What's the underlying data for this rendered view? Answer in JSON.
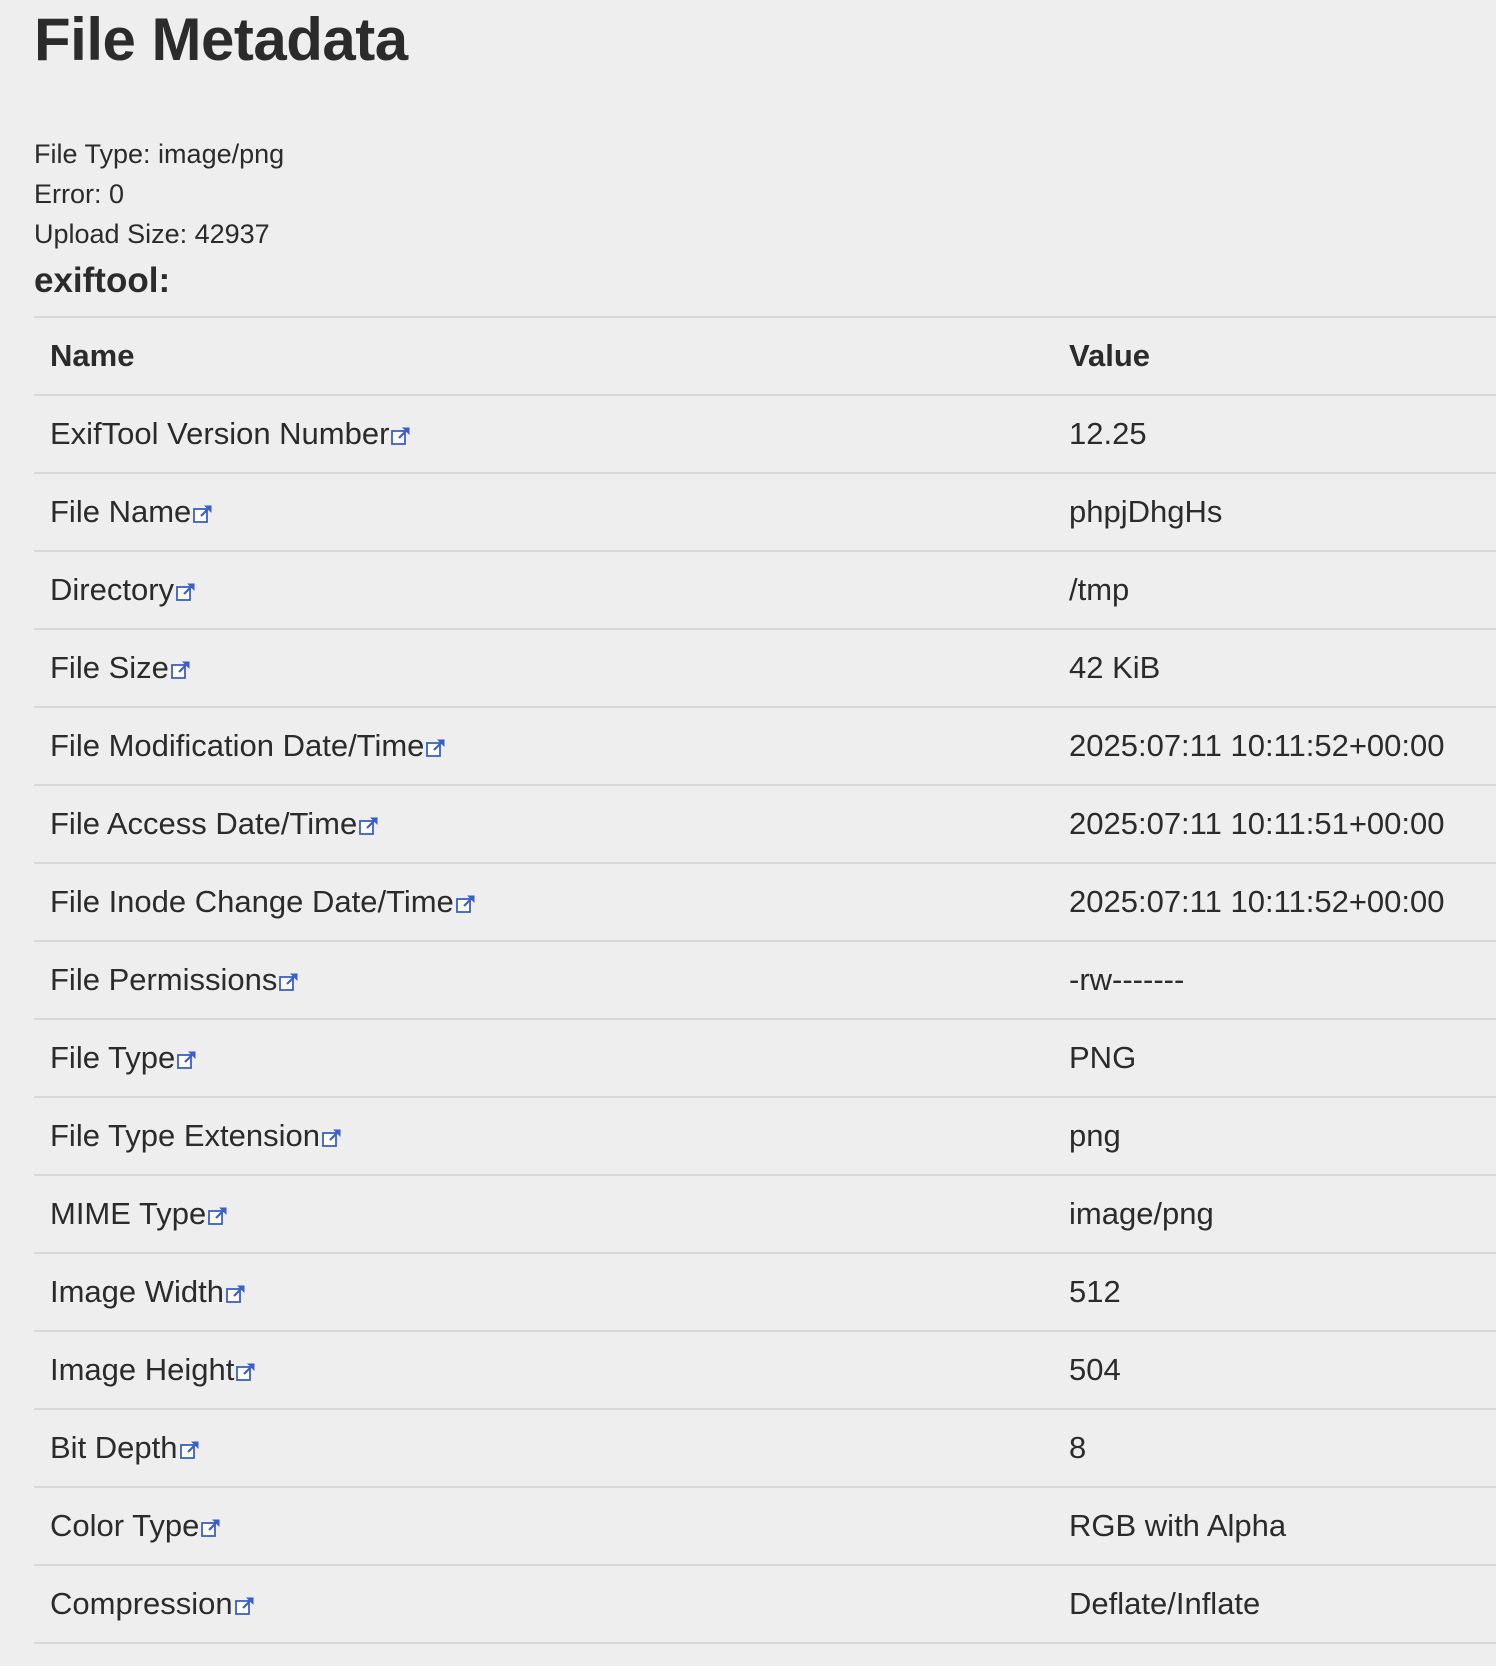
{
  "page": {
    "title": "File Metadata"
  },
  "upload_info": {
    "file_type": "File Type: image/png",
    "error": "Error: 0",
    "upload_size": "Upload Size: 42937"
  },
  "section": {
    "heading": "exiftool:"
  },
  "table": {
    "headers": {
      "name": "Name",
      "value": "Value"
    },
    "rows": [
      {
        "name": "ExifTool Version Number",
        "value": "12.25"
      },
      {
        "name": "File Name",
        "value": "phpjDhgHs"
      },
      {
        "name": "Directory",
        "value": "/tmp"
      },
      {
        "name": "File Size",
        "value": "42 KiB"
      },
      {
        "name": "File Modification Date/Time",
        "value": "2025:07:11 10:11:52+00:00"
      },
      {
        "name": "File Access Date/Time",
        "value": "2025:07:11 10:11:51+00:00"
      },
      {
        "name": "File Inode Change Date/Time",
        "value": "2025:07:11 10:11:52+00:00"
      },
      {
        "name": "File Permissions",
        "value": "-rw-------"
      },
      {
        "name": "File Type",
        "value": "PNG"
      },
      {
        "name": "File Type Extension",
        "value": "png"
      },
      {
        "name": "MIME Type",
        "value": "image/png"
      },
      {
        "name": "Image Width",
        "value": "512"
      },
      {
        "name": "Image Height",
        "value": "504"
      },
      {
        "name": "Bit Depth",
        "value": "8"
      },
      {
        "name": "Color Type",
        "value": "RGB with Alpha"
      },
      {
        "name": "Compression",
        "value": "Deflate/Inflate"
      }
    ]
  },
  "icons": {
    "row_link": "external-link-icon"
  },
  "colors": {
    "background": "#eeeeee",
    "text": "#2b2b2b",
    "row_border": "#d8d8d8",
    "link_icon": "#3a5fc8"
  }
}
